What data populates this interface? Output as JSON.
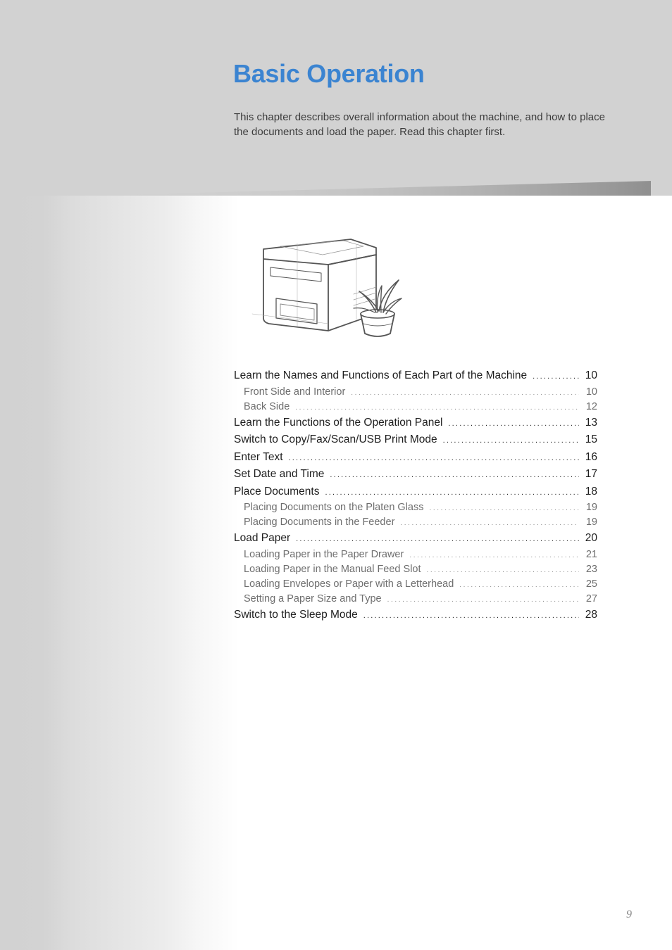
{
  "chapter": {
    "title": "Basic Operation",
    "intro": "This chapter describes overall information about the machine, and how to place the documents and load the paper. Read this chapter first.",
    "title_color": "#3b84d1"
  },
  "illustration": {
    "icon": "printer-with-plant-sketch",
    "description": "Sketch of a printer with a potted plant"
  },
  "toc": [
    {
      "label": "Learn the Names and Functions of Each Part of the Machine",
      "page": "10",
      "level": 1
    },
    {
      "label": "Front Side and Interior",
      "page": "10",
      "level": 2
    },
    {
      "label": "Back Side",
      "page": "12",
      "level": 2
    },
    {
      "label": "Learn the Functions of the Operation Panel",
      "page": "13",
      "level": 1
    },
    {
      "label": "Switch to Copy/Fax/Scan/USB Print Mode",
      "page": "15",
      "level": 1
    },
    {
      "label": "Enter Text",
      "page": "16",
      "level": 1
    },
    {
      "label": "Set Date and Time",
      "page": "17",
      "level": 1
    },
    {
      "label": "Place Documents",
      "page": "18",
      "level": 1
    },
    {
      "label": "Placing Documents on the Platen Glass",
      "page": "19",
      "level": 2
    },
    {
      "label": "Placing Documents in the Feeder",
      "page": "19",
      "level": 2
    },
    {
      "label": "Load Paper",
      "page": "20",
      "level": 1
    },
    {
      "label": "Loading Paper in the Paper Drawer",
      "page": "21",
      "level": 2
    },
    {
      "label": "Loading Paper in the Manual Feed Slot",
      "page": "23",
      "level": 2
    },
    {
      "label": "Loading Envelopes or Paper with a Letterhead",
      "page": "25",
      "level": 2
    },
    {
      "label": "Setting a Paper Size and Type",
      "page": "27",
      "level": 2
    },
    {
      "label": "Switch to the Sleep Mode",
      "page": "28",
      "level": 1
    }
  ],
  "footer": {
    "page_number": "9"
  }
}
